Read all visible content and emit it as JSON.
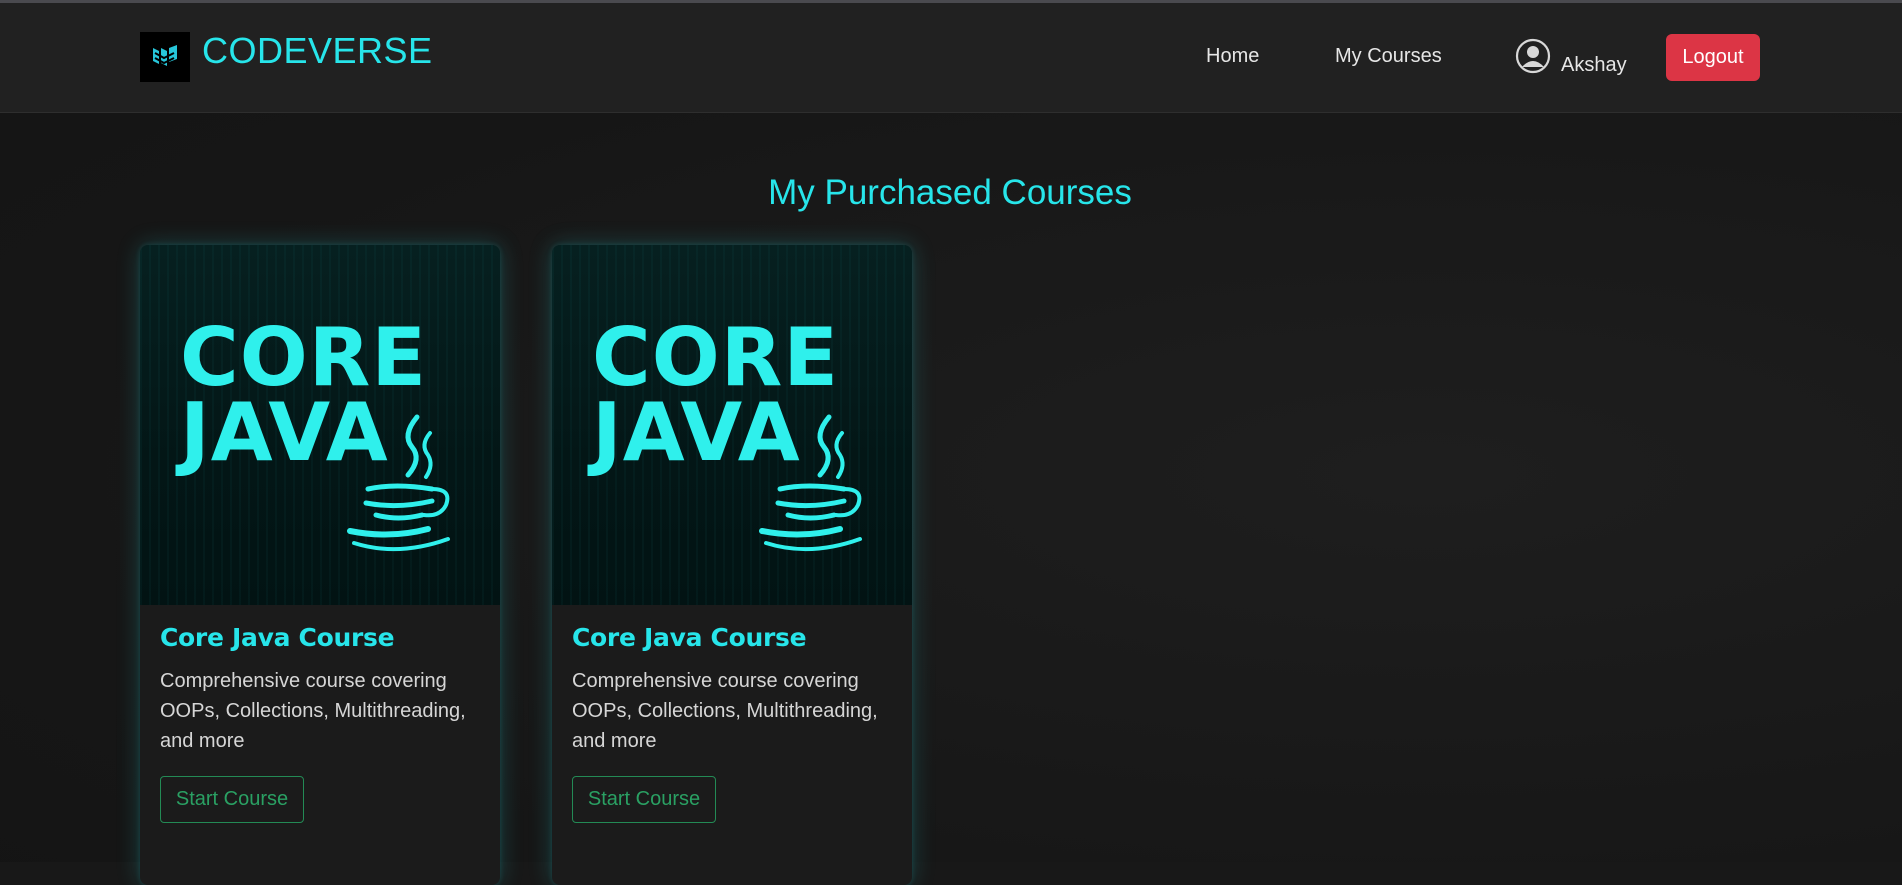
{
  "brand": {
    "name": "CODEVERSE",
    "logo_icon": "codeverse-logo-icon"
  },
  "nav": {
    "home": "Home",
    "my_courses": "My Courses",
    "user_name": "Akshay",
    "user_icon": "user-avatar-icon",
    "logout": "Logout"
  },
  "page": {
    "title": "My Purchased Courses"
  },
  "colors": {
    "accent": "#27e5ea",
    "logout": "#dc3545",
    "start_button": "#2aa063",
    "background": "#181818"
  },
  "courses": [
    {
      "image_text": [
        "CORE",
        "JAVA"
      ],
      "image_icon": "java-coffee-cup-icon",
      "title": "Core Java Course",
      "description": "Comprehensive course covering OOPs, Collections, Multithreading, and more",
      "button": "Start Course"
    },
    {
      "image_text": [
        "CORE",
        "JAVA"
      ],
      "image_icon": "java-coffee-cup-icon",
      "title": "Core Java Course",
      "description": "Comprehensive course covering OOPs, Collections, Multithreading, and more",
      "button": "Start Course"
    }
  ]
}
